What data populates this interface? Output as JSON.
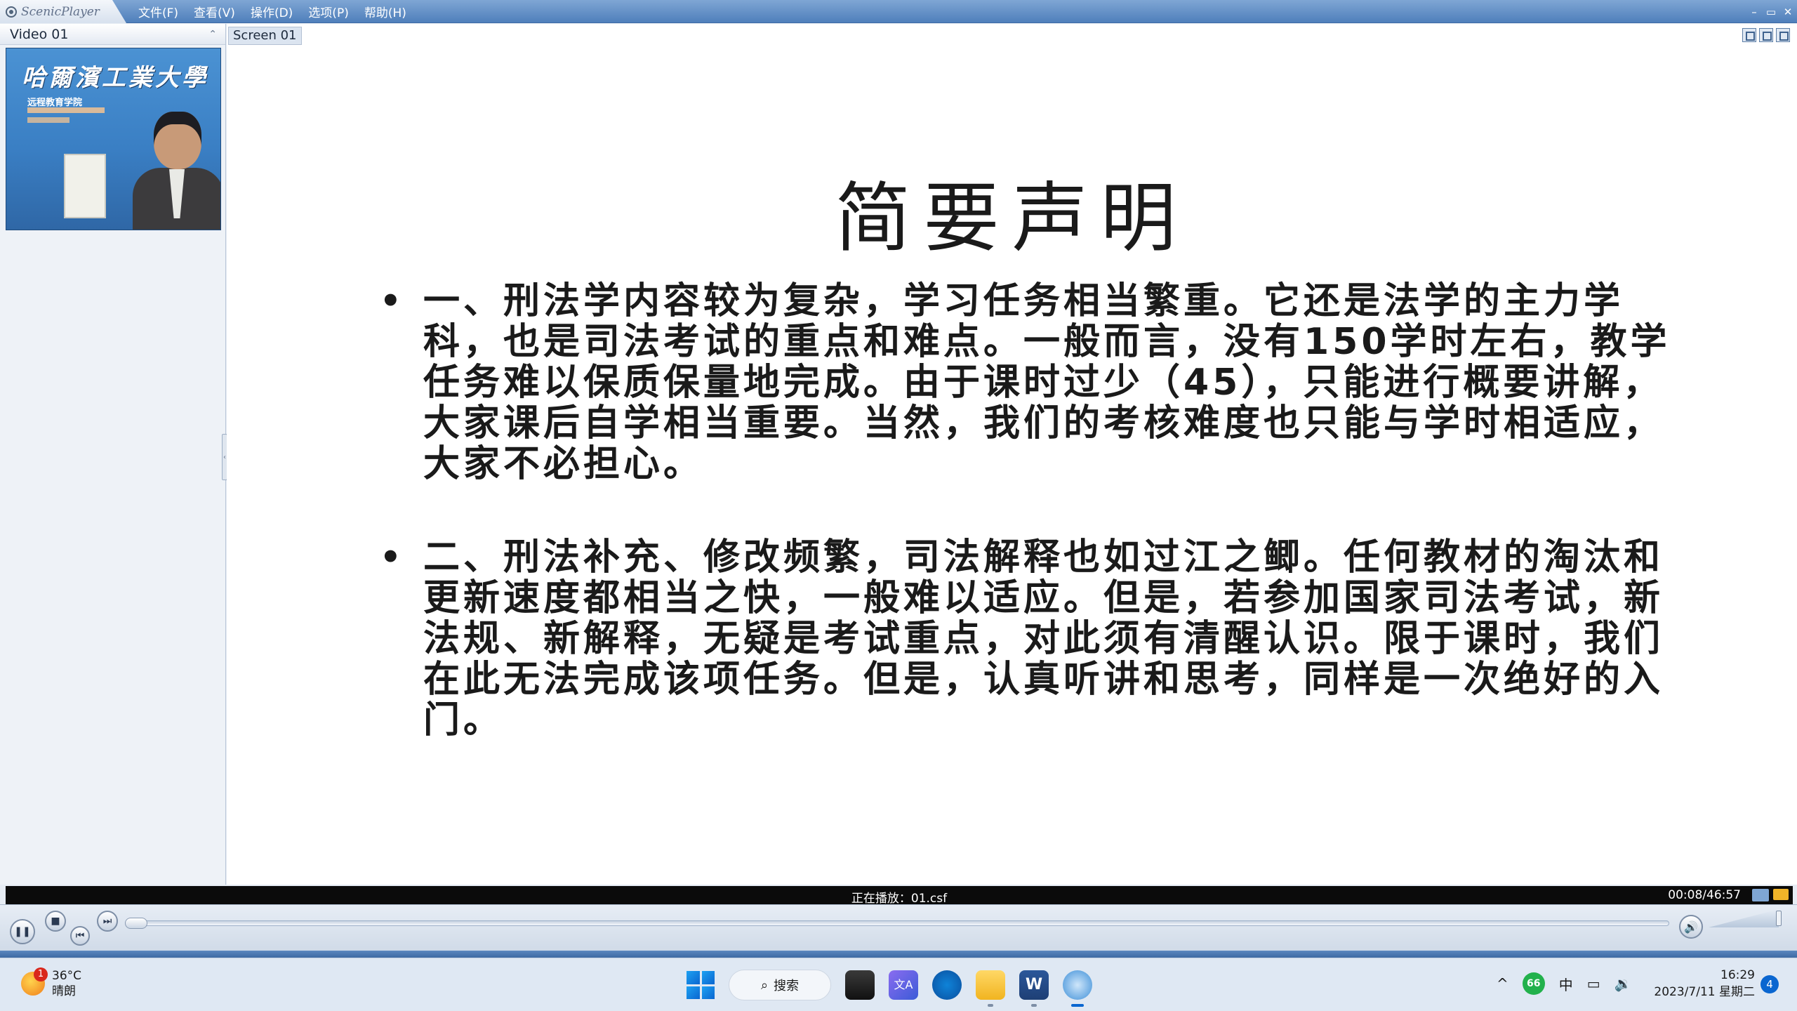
{
  "app": {
    "name": "ScenicPlayer",
    "menu": [
      "文件(F)",
      "查看(V)",
      "操作(D)",
      "选项(P)",
      "帮助(H)"
    ],
    "window_controls": [
      "–",
      "▭",
      "✕"
    ]
  },
  "left_panel": {
    "title": "Video 01",
    "collapse_glyph": "⌃",
    "video_banner": "哈爾濱工業大學",
    "video_subtitle": "远程教育学院"
  },
  "screen": {
    "tab_label": "Screen 01",
    "slide": {
      "title": "简要声明",
      "bullets": [
        "一、刑法学内容较为复杂，学习任务相当繁重。它还是法学的主力学科，也是司法考试的重点和难点。一般而言，没有150学时左右，教学任务难以保质保量地完成。由于课时过少（45），只能进行概要讲解，大家课后自学相当重要。当然，我们的考核难度也只能与学时相适应，大家不必担心。",
        "二、刑法补充、修改频繁，司法解释也如过江之鲫。任何教材的淘汰和更新速度都相当之快，一般难以适应。但是，若参加国家司法考试，新法规、新解释，无疑是考试重点，对此须有清醒认识。限于课时，我们在此无法完成该项任务。但是，认真听讲和思考，同样是一次绝好的入门。"
      ],
      "bullet_glyph": "•"
    }
  },
  "status": {
    "now_playing": "正在播放：01.csf",
    "time": "00:08/46:57"
  },
  "controls": {
    "pause_glyph": "❚❚",
    "stop_glyph": "■",
    "prev_glyph": "⏮",
    "next_glyph": "⏭",
    "volume_glyph": "🔊"
  },
  "taskbar": {
    "weather": {
      "temp": "36°C",
      "condition": "晴朗",
      "badge": "1"
    },
    "search_label": "搜索",
    "word_label": "W",
    "translate_label": "文A",
    "tray": {
      "green_label": "66",
      "ime": "中",
      "chevron": "^"
    },
    "clock": {
      "time": "16:29",
      "date": "2023/7/11 星期二"
    },
    "notifications": "4"
  },
  "colors": {
    "titlebar": "#4f7fbb",
    "status_bar": "#0b0b0b",
    "accent": "#0a66d0"
  }
}
